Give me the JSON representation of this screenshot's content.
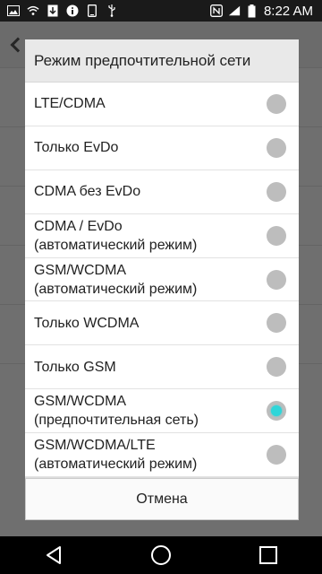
{
  "status_bar": {
    "time": "8:22 AM",
    "left_icons": [
      "image-icon",
      "wifi-icon",
      "download-icon",
      "info-icon",
      "phone-icon",
      "usb-icon"
    ],
    "right_icons": [
      "nfc-icon",
      "signal-icon",
      "battery-icon"
    ]
  },
  "dialog": {
    "title": "Режим предпочтительной сети",
    "options": [
      {
        "label": "LTE/CDMA",
        "selected": false
      },
      {
        "label": "Только EvDo",
        "selected": false
      },
      {
        "label": "CDMA без EvDo",
        "selected": false
      },
      {
        "label": "CDMA / EvDo\n(автоматический режим)",
        "selected": false
      },
      {
        "label": "GSM/WCDMA\n(автоматический режим)",
        "selected": false
      },
      {
        "label": "Только WCDMA",
        "selected": false
      },
      {
        "label": "Только GSM",
        "selected": false
      },
      {
        "label": "GSM/WCDMA\n(предпочтительная сеть)",
        "selected": true
      },
      {
        "label": "GSM/WCDMA/LTE\n(автоматический режим)",
        "selected": false
      }
    ],
    "cancel_label": "Отмена",
    "selected_color": "#2fd6d9"
  },
  "nav_bar": {
    "buttons": [
      "back-icon",
      "home-icon",
      "recents-icon"
    ]
  }
}
